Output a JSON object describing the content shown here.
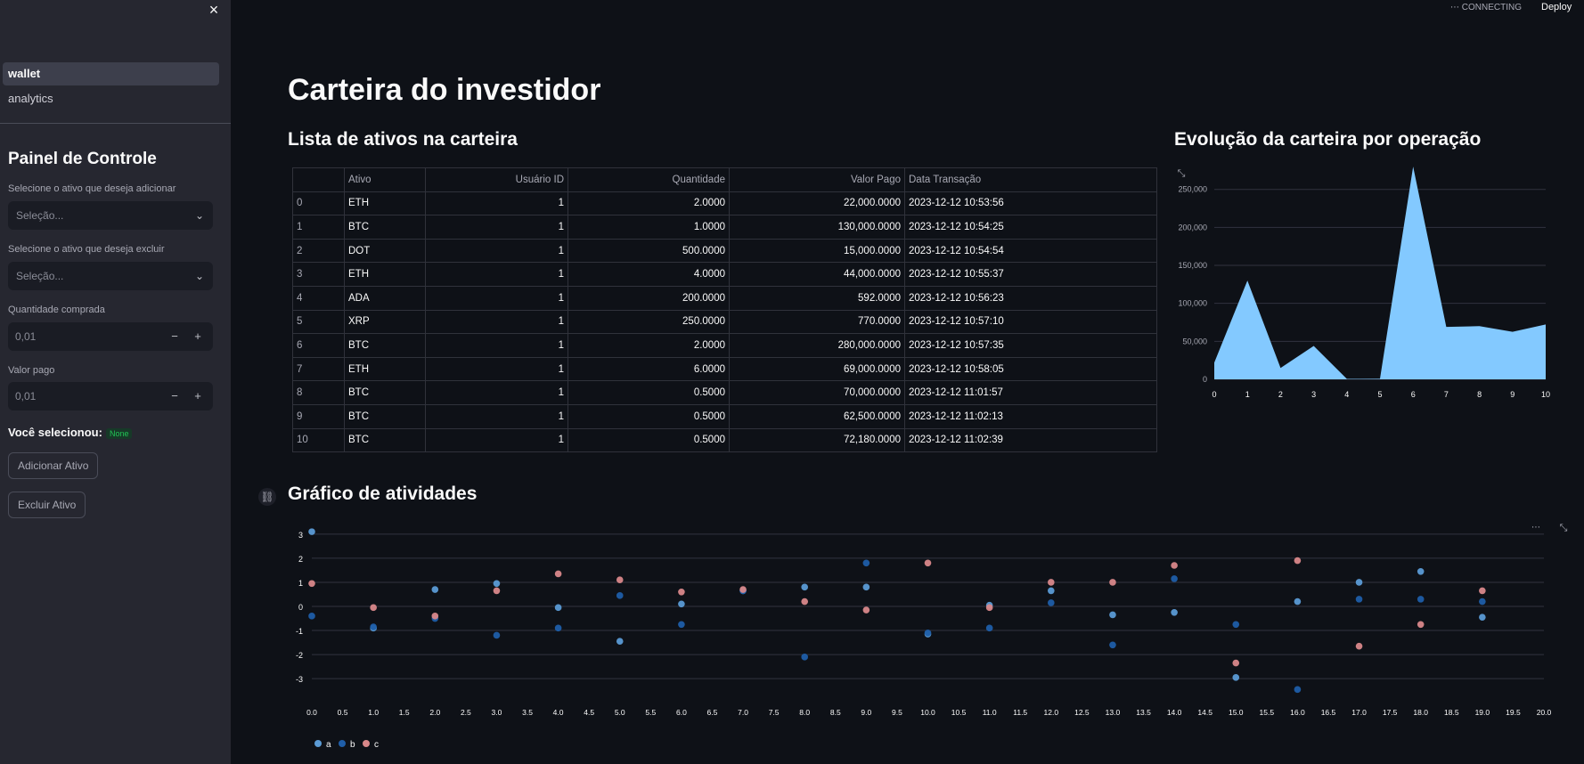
{
  "sidebar": {
    "close_icon": "×",
    "nav": [
      {
        "label": "wallet",
        "active": true
      },
      {
        "label": "analytics",
        "active": false
      }
    ],
    "title": "Painel de Controle",
    "add_label": "Selecione o ativo que deseja adicionar",
    "add_placeholder": "Seleção...",
    "remove_label": "Selecione o ativo que deseja excluir",
    "remove_placeholder": "Seleção...",
    "qty_label": "Quantidade comprada",
    "qty_value": "0,01",
    "paid_label": "Valor pago",
    "paid_value": "0,01",
    "selected_text": "Você selecionou:",
    "selected_badge": "None",
    "add_button": "Adicionar Ativo",
    "remove_button": "Excluir Ativo"
  },
  "topbar": {
    "status": "CONNECTING",
    "deploy": "Deploy"
  },
  "main": {
    "title": "Carteira do investidor",
    "list_title": "Lista de ativos na carteira",
    "evolution_title": "Evolução da carteira por operação",
    "activity_title": "Gráfico de atividades"
  },
  "table": {
    "columns": [
      "",
      "Ativo",
      "Usuário ID",
      "Quantidade",
      "Valor Pago",
      "Data Transação"
    ],
    "rows": [
      [
        "0",
        "ETH",
        "1",
        "2.0000",
        "22,000.0000",
        "2023-12-12 10:53:56"
      ],
      [
        "1",
        "BTC",
        "1",
        "1.0000",
        "130,000.0000",
        "2023-12-12 10:54:25"
      ],
      [
        "2",
        "DOT",
        "1",
        "500.0000",
        "15,000.0000",
        "2023-12-12 10:54:54"
      ],
      [
        "3",
        "ETH",
        "1",
        "4.0000",
        "44,000.0000",
        "2023-12-12 10:55:37"
      ],
      [
        "4",
        "ADA",
        "1",
        "200.0000",
        "592.0000",
        "2023-12-12 10:56:23"
      ],
      [
        "5",
        "XRP",
        "1",
        "250.0000",
        "770.0000",
        "2023-12-12 10:57:10"
      ],
      [
        "6",
        "BTC",
        "1",
        "2.0000",
        "280,000.0000",
        "2023-12-12 10:57:35"
      ],
      [
        "7",
        "ETH",
        "1",
        "6.0000",
        "69,000.0000",
        "2023-12-12 10:58:05"
      ],
      [
        "8",
        "BTC",
        "1",
        "0.5000",
        "70,000.0000",
        "2023-12-12 11:01:57"
      ],
      [
        "9",
        "BTC",
        "1",
        "0.5000",
        "62,500.0000",
        "2023-12-12 11:02:13"
      ],
      [
        "10",
        "BTC",
        "1",
        "0.5000",
        "72,180.0000",
        "2023-12-12 11:02:39"
      ]
    ]
  },
  "chart_data": [
    {
      "type": "area",
      "x": [
        0,
        1,
        2,
        3,
        4,
        5,
        6,
        7,
        8,
        9,
        10
      ],
      "values": [
        22000,
        130000,
        15000,
        44000,
        592,
        770,
        280000,
        69000,
        70000,
        62500,
        72180
      ],
      "xlim": [
        0,
        10
      ],
      "ylim": [
        0,
        250000
      ],
      "yticks": [
        0,
        50000,
        100000,
        150000,
        200000,
        250000
      ],
      "ytick_labels": [
        "0",
        "50,000",
        "100,000",
        "150,000",
        "200,000",
        "250,000"
      ],
      "xticks": [
        "0",
        "1",
        "2",
        "3",
        "4",
        "5",
        "6",
        "7",
        "8",
        "9",
        "10"
      ],
      "grid": true,
      "color": "#83c9ff"
    },
    {
      "type": "scatter",
      "x": [
        0,
        1,
        2,
        3,
        4,
        5,
        6,
        7,
        8,
        9,
        10,
        11,
        12,
        13,
        14,
        15,
        16,
        17,
        18,
        19
      ],
      "series": [
        {
          "name": "a",
          "color": "#5b9bd5",
          "values": [
            3.1,
            -0.9,
            0.7,
            0.95,
            -0.05,
            -1.45,
            0.1,
            0.65,
            0.8,
            0.8,
            -1.15,
            0.05,
            0.65,
            -0.35,
            -0.25,
            -2.95,
            0.2,
            1.0,
            1.45,
            -0.45
          ]
        },
        {
          "name": "b",
          "color": "#1f5ea8",
          "values": [
            -0.4,
            -0.85,
            -0.5,
            -1.2,
            -0.9,
            0.45,
            -0.75,
            0.65,
            -2.1,
            1.8,
            -1.1,
            -0.9,
            0.15,
            -1.6,
            1.15,
            -0.75,
            -3.45,
            0.3,
            0.3,
            0.2
          ]
        },
        {
          "name": "c",
          "color": "#d9888a",
          "values": [
            0.95,
            -0.05,
            -0.4,
            0.65,
            1.35,
            1.1,
            0.6,
            0.7,
            0.2,
            -0.15,
            1.8,
            -0.05,
            1.0,
            1.0,
            1.7,
            -2.35,
            1.9,
            -1.65,
            -0.75,
            0.65
          ]
        }
      ],
      "xlim": [
        0,
        20
      ],
      "ylim": [
        -3.4,
        3.4
      ],
      "yticks": [
        -3,
        -2,
        -1,
        0,
        1,
        2,
        3
      ],
      "xticks": [
        "0.0",
        "0.5",
        "1.0",
        "1.5",
        "2.0",
        "2.5",
        "3.0",
        "3.5",
        "4.0",
        "4.5",
        "5.0",
        "5.5",
        "6.0",
        "6.5",
        "7.0",
        "7.5",
        "8.0",
        "8.5",
        "9.0",
        "9.5",
        "10.0",
        "10.5",
        "11.0",
        "11.5",
        "12.0",
        "12.5",
        "13.0",
        "13.5",
        "14.0",
        "14.5",
        "15.0",
        "15.5",
        "16.0",
        "16.5",
        "17.0",
        "17.5",
        "18.0",
        "18.5",
        "19.0",
        "19.5",
        "20.0"
      ],
      "grid": true,
      "legend": "bottom-left"
    }
  ]
}
